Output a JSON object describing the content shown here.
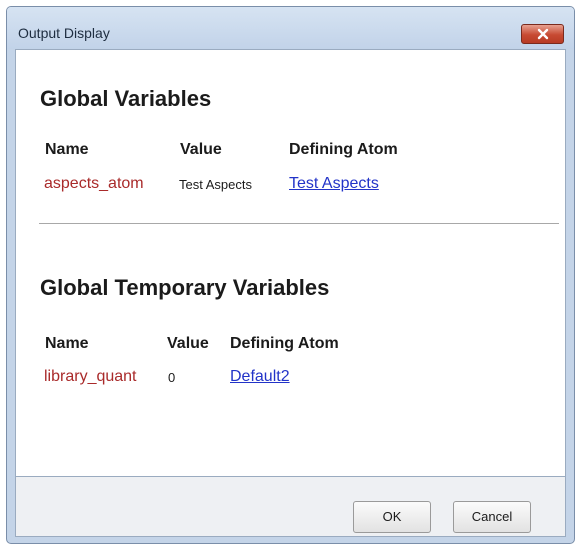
{
  "window": {
    "title": "Output Display"
  },
  "global_variables": {
    "heading": "Global Variables",
    "columns": {
      "name": "Name",
      "value": "Value",
      "atom": "Defining Atom"
    },
    "rows": [
      {
        "name": "aspects_atom",
        "value": "Test Aspects",
        "atom": "Test Aspects"
      }
    ]
  },
  "global_temporary_variables": {
    "heading": "Global Temporary Variables",
    "columns": {
      "name": "Name",
      "value": "Value",
      "atom": "Defining Atom"
    },
    "rows": [
      {
        "name": "library_quant",
        "value": "0",
        "atom": "Default2"
      }
    ]
  },
  "buttons": {
    "ok": "OK",
    "cancel": "Cancel"
  },
  "colors": {
    "variable_name": "#a92a2a",
    "link": "#2233c8",
    "close_button": "#c74a32"
  }
}
